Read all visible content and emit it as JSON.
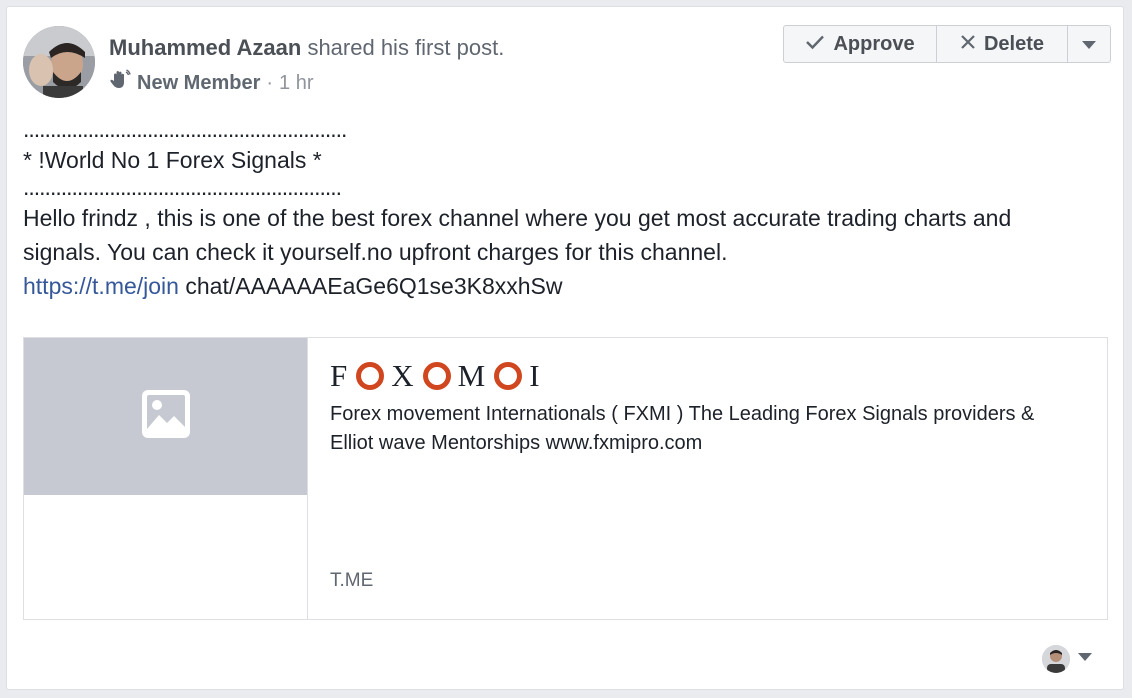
{
  "post": {
    "author": "Muhammed Azaan",
    "action": " shared his first post.",
    "badge": "New Member",
    "separator": "·",
    "time": "1 hr",
    "dots_1": "............................................................",
    "line_title": "* !World No 1 Forex Signals *",
    "dots_2": "...........................................................",
    "paragraph": "Hello frindz , this is one of the best forex channel where you get most accurate trading charts and signals. You can check it yourself.no upfront charges for this channel.",
    "link_text": "https://t.me/join",
    "link_rest": " chat/AAAAAAEaGe6Q1se3K8xxhSw"
  },
  "actions": {
    "approve_label": "Approve",
    "delete_label": "Delete"
  },
  "preview": {
    "brand_letters": [
      "F",
      "X",
      "M",
      "I"
    ],
    "description": "Forex movement Internationals ( FXMI ) The Leading Forex Signals providers & Elliot wave Mentorships www.fxmipro.com",
    "domain": "T.ME"
  },
  "colors": {
    "link": "#365899",
    "brand_ring": "#d0461f",
    "thumb_bg": "#c6c9d1"
  }
}
